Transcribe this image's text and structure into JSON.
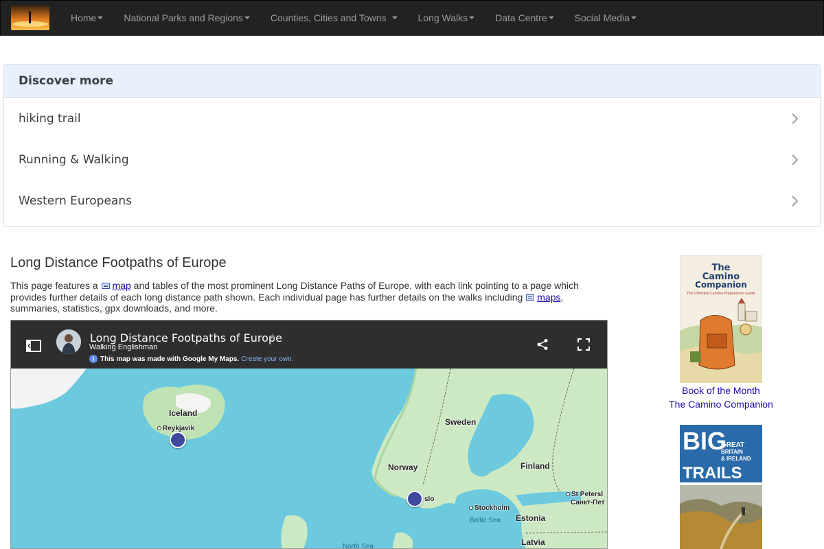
{
  "nav": {
    "items": [
      {
        "label": "Home"
      },
      {
        "label": "National Parks and Regions"
      },
      {
        "label": "Counties, Cities and Towns"
      },
      {
        "label": "Long Walks"
      },
      {
        "label": "Data Centre"
      },
      {
        "label": "Social Media"
      }
    ]
  },
  "discover": {
    "heading": "Discover more",
    "items": [
      {
        "label": "hiking trail"
      },
      {
        "label": "Running & Walking"
      },
      {
        "label": "Western Europeans"
      }
    ]
  },
  "main": {
    "title": "Long Distance Footpaths of Europe",
    "intro_1": "This page features a ",
    "intro_link_1": "map",
    "intro_2": " and tables of the most prominent Long Distance Paths of Europe, with each link pointing to a page which provides further details of each long distance path shown. Each individual page has further details on the walks including ",
    "intro_link_2": "maps",
    "intro_3": ", summaries, statistics, gpx downloads, and more."
  },
  "map": {
    "title": "Long Distance Footpaths of Europe",
    "subtitle": "Walking Englishman",
    "notice": "This map was made with Google My Maps.",
    "notice_link": "Create your own.",
    "labels": {
      "iceland": "Iceland",
      "reykjavik": "Reykjavik",
      "sweden": "Sweden",
      "norway": "Norway",
      "finland": "Finland",
      "oslo": "slo",
      "stockholm": "Stockholm",
      "st_petersburg": "St Petersl",
      "st_petersburg_ru": "Санкт-Пет",
      "estonia": "Estonia",
      "baltic": "Baltic Sea",
      "latvia": "Latvia",
      "north_sea": "North Sea"
    }
  },
  "sidebar": {
    "book1": {
      "cover_title_1": "The",
      "cover_title_2": "Camino",
      "cover_title_3": "Companion",
      "cover_sub": "The Ultimate Camino Preparation Guide",
      "caption_1": "Book of the Month",
      "caption_2": "The Camino Companion"
    },
    "book2": {
      "cover_big": "BIG",
      "cover_trails": "TRAILS",
      "cover_side_1": "GREAT",
      "cover_side_2": "BRITAIN",
      "cover_side_3": "& IRELAND"
    }
  }
}
